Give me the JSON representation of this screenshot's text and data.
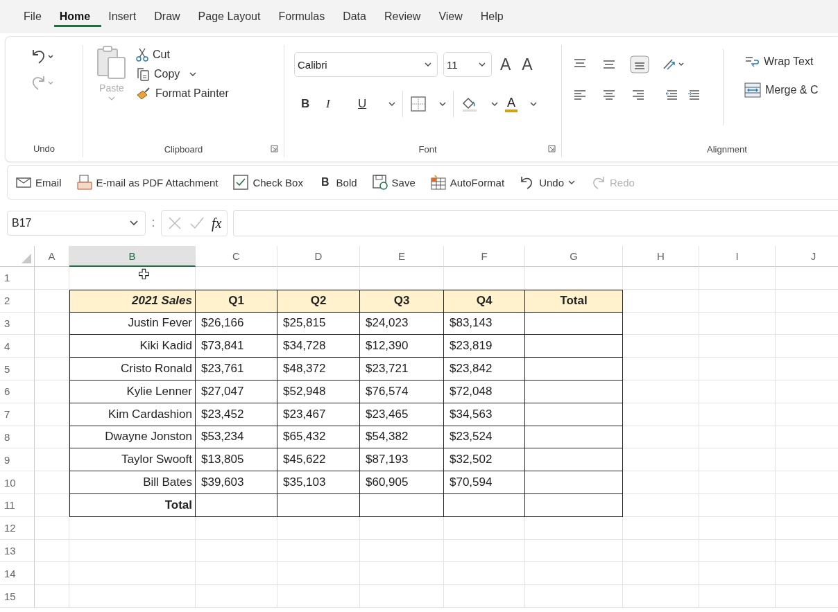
{
  "tabs": [
    {
      "label": "File",
      "selected": false
    },
    {
      "label": "Home",
      "selected": true
    },
    {
      "label": "Insert",
      "selected": false
    },
    {
      "label": "Draw",
      "selected": false
    },
    {
      "label": "Page Layout",
      "selected": false
    },
    {
      "label": "Formulas",
      "selected": false
    },
    {
      "label": "Data",
      "selected": false
    },
    {
      "label": "Review",
      "selected": false
    },
    {
      "label": "View",
      "selected": false
    },
    {
      "label": "Help",
      "selected": false
    }
  ],
  "ribbon": {
    "undo_group": {
      "label": "Undo",
      "buttons": [
        {
          "kind": "undo",
          "disabled": false
        },
        {
          "kind": "redo",
          "disabled": true
        }
      ]
    },
    "clipboard_group": {
      "label": "Clipboard",
      "paste": {
        "label": "Paste",
        "disabled": true
      },
      "items": [
        {
          "kind": "cut",
          "label": "Cut"
        },
        {
          "kind": "copy",
          "label": "Copy"
        },
        {
          "kind": "painter",
          "label": "Format Painter"
        }
      ]
    },
    "font_group": {
      "label": "Font",
      "font_name": "Calibri",
      "font_size": "11",
      "size_buttons": [
        "A",
        "A"
      ],
      "format_buttons": [
        "B",
        "I",
        "U"
      ],
      "font_color_glyph": "A"
    },
    "alignment_group": {
      "label": "Alignment",
      "wrap_text": "Wrap Text",
      "merge": "Merge & C"
    }
  },
  "quick_access": [
    {
      "kind": "email",
      "label": "Email",
      "disabled": false
    },
    {
      "kind": "pdf",
      "label": "E-mail as PDF Attachment",
      "disabled": false
    },
    {
      "kind": "checkbox",
      "label": "Check Box",
      "disabled": false
    },
    {
      "kind": "bold",
      "glyph": "B",
      "label": "Bold",
      "disabled": false
    },
    {
      "kind": "save",
      "label": "Save",
      "disabled": false
    },
    {
      "kind": "autoformat",
      "label": "AutoFormat",
      "disabled": false
    },
    {
      "kind": "undo",
      "label": "Undo",
      "disabled": false
    },
    {
      "kind": "redo",
      "label": "Redo",
      "disabled": true
    }
  ],
  "formula_bar": {
    "name_box": "B17",
    "function_label": "fx"
  },
  "sheet": {
    "columns": [
      {
        "label": "A",
        "selected": false
      },
      {
        "label": "B",
        "selected": true
      },
      {
        "label": "C",
        "selected": false
      },
      {
        "label": "D",
        "selected": false
      },
      {
        "label": "E",
        "selected": false
      },
      {
        "label": "F",
        "selected": false
      },
      {
        "label": "G",
        "selected": false
      },
      {
        "label": "H",
        "selected": false
      },
      {
        "label": "I",
        "selected": false
      },
      {
        "label": "J",
        "selected": false
      }
    ],
    "row_numbers": [
      "1",
      "2",
      "3",
      "4",
      "5",
      "6",
      "7",
      "8",
      "9",
      "10",
      "11",
      "12",
      "13",
      "14",
      "15"
    ],
    "table": {
      "header": [
        "2021 Sales",
        "Q1",
        "Q2",
        "Q3",
        "Q4",
        "Total"
      ],
      "rows": [
        {
          "name": "Justin Fever",
          "values": [
            "$26,166",
            "$25,815",
            "$24,023",
            "$83,143"
          ]
        },
        {
          "name": "Kiki Kadid",
          "values": [
            "$73,841",
            "$34,728",
            "$12,390",
            "$23,819"
          ]
        },
        {
          "name": "Cristo Ronald",
          "values": [
            "$23,761",
            "$48,372",
            "$23,721",
            "$23,842"
          ]
        },
        {
          "name": "Kylie Lenner",
          "values": [
            "$27,047",
            "$52,948",
            "$76,574",
            "$72,048"
          ]
        },
        {
          "name": "Kim Cardashion",
          "values": [
            "$23,452",
            "$23,467",
            "$23,465",
            "$34,563"
          ]
        },
        {
          "name": "Dwayne Jonston",
          "values": [
            "$53,234",
            "$65,432",
            "$54,382",
            "$23,524"
          ]
        },
        {
          "name": "Taylor Swooft",
          "values": [
            "$13,805",
            "$45,622",
            "$87,193",
            "$32,502"
          ]
        },
        {
          "name": "Bill Bates",
          "values": [
            "$39,603",
            "$35,103",
            "$60,905",
            "$70,594"
          ]
        }
      ],
      "total_label": "Total"
    }
  }
}
